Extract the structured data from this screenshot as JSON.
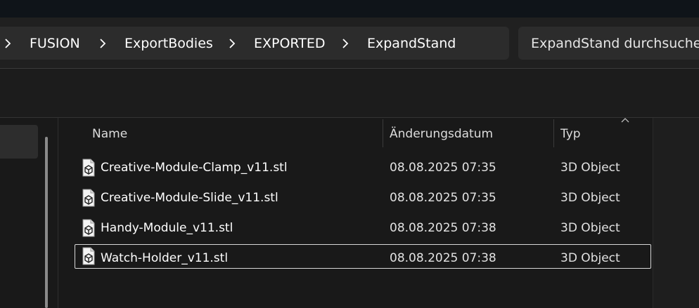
{
  "breadcrumb": {
    "items": [
      {
        "label": "FUSION"
      },
      {
        "label": "ExportBodies"
      },
      {
        "label": "EXPORTED"
      },
      {
        "label": "ExpandStand"
      }
    ]
  },
  "search": {
    "placeholder": "ExpandStand durchsuchen"
  },
  "columns": {
    "name": "Name",
    "date": "Änderungsdatum",
    "type": "Typ"
  },
  "files": [
    {
      "name": "Creative-Module-Clamp_v11.stl",
      "date": "08.08.2025 07:35",
      "type": "3D Object",
      "icon": "stl-file-icon"
    },
    {
      "name": "Creative-Module-Slide_v11.stl",
      "date": "08.08.2025 07:35",
      "type": "3D Object",
      "icon": "stl-file-icon"
    },
    {
      "name": "Handy-Module_v11.stl",
      "date": "08.08.2025 07:38",
      "type": "3D Object",
      "icon": "stl-file-icon"
    },
    {
      "name": "Watch-Holder_v11.stl",
      "date": "08.08.2025 07:38",
      "type": "3D Object",
      "icon": "stl-file-icon",
      "selected": true
    }
  ]
}
